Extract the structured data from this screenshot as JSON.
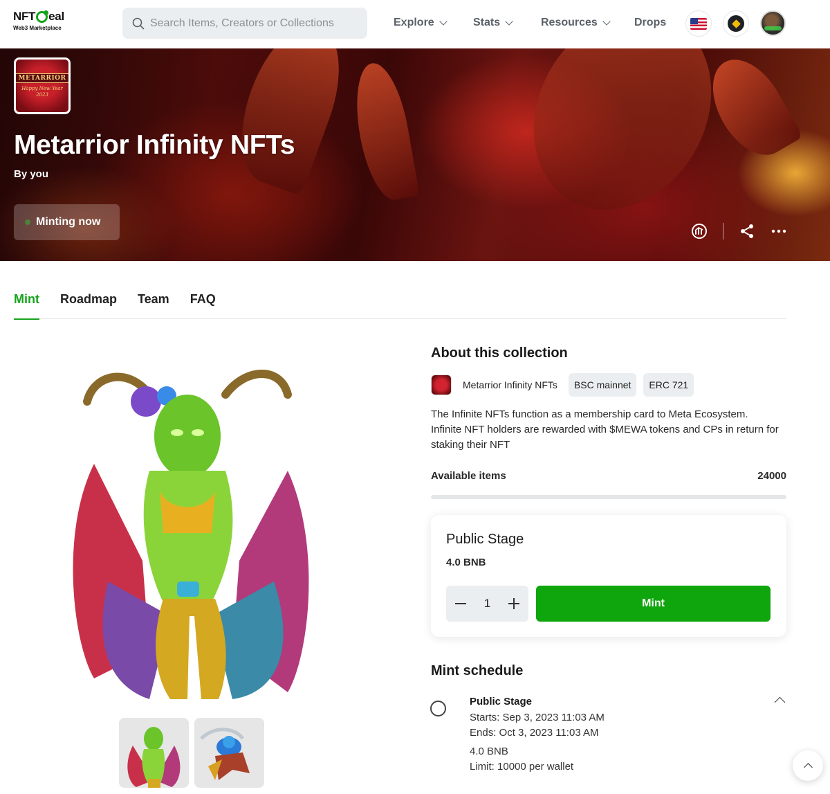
{
  "header": {
    "logo": {
      "main": "NFTDeal",
      "sub": "Web3 Marketplace"
    },
    "search": {
      "placeholder": "Search Items, Creators or Collections"
    },
    "nav": [
      {
        "label": "Explore",
        "has_dropdown": true
      },
      {
        "label": "Stats",
        "has_dropdown": true
      },
      {
        "label": "Resources",
        "has_dropdown": true
      },
      {
        "label": "Drops",
        "has_dropdown": false
      }
    ],
    "language_icon": "us-flag-icon",
    "network_icon": "bnb-chain-icon",
    "avatar": "user-avatar"
  },
  "banner": {
    "thumb_badge": "METARRIOR",
    "thumb_sub": "Happy New Year 2023",
    "title": "Metarrior Infinity NFTs",
    "by": "By you",
    "status_button": "Minting now",
    "actions": [
      "stats-icon",
      "share-icon",
      "more-icon"
    ]
  },
  "tabs": [
    {
      "label": "Mint",
      "active": true
    },
    {
      "label": "Roadmap",
      "active": false
    },
    {
      "label": "Team",
      "active": false
    },
    {
      "label": "FAQ",
      "active": false
    }
  ],
  "about": {
    "title": "About this collection",
    "collection_name": "Metarrior Infinity NFTs",
    "chips": [
      "BSC mainnet",
      "ERC 721"
    ],
    "description": "The Infinite NFTs function as a membership card to Meta Ecosystem. Infinite NFT holders are rewarded with $MEWA tokens and CPs in return for staking their NFT",
    "available_label": "Available items",
    "available_value": "24000",
    "minted_fraction": 0
  },
  "stage_card": {
    "title": "Public Stage",
    "price": "4.0 BNB",
    "quantity": "1",
    "mint_label": "Mint"
  },
  "schedule": {
    "title": "Mint schedule",
    "items": [
      {
        "name": "Public Stage",
        "starts": "Starts: Sep 3, 2023 11:03 AM",
        "ends": "Ends: Oct 3, 2023 11:03 AM",
        "price": "4.0 BNB",
        "limit": "Limit: 10000 per wallet"
      }
    ]
  },
  "colors": {
    "accent": "#15a31c",
    "mint_button": "#0fa60d",
    "chip_bg": "#ebeef0"
  }
}
